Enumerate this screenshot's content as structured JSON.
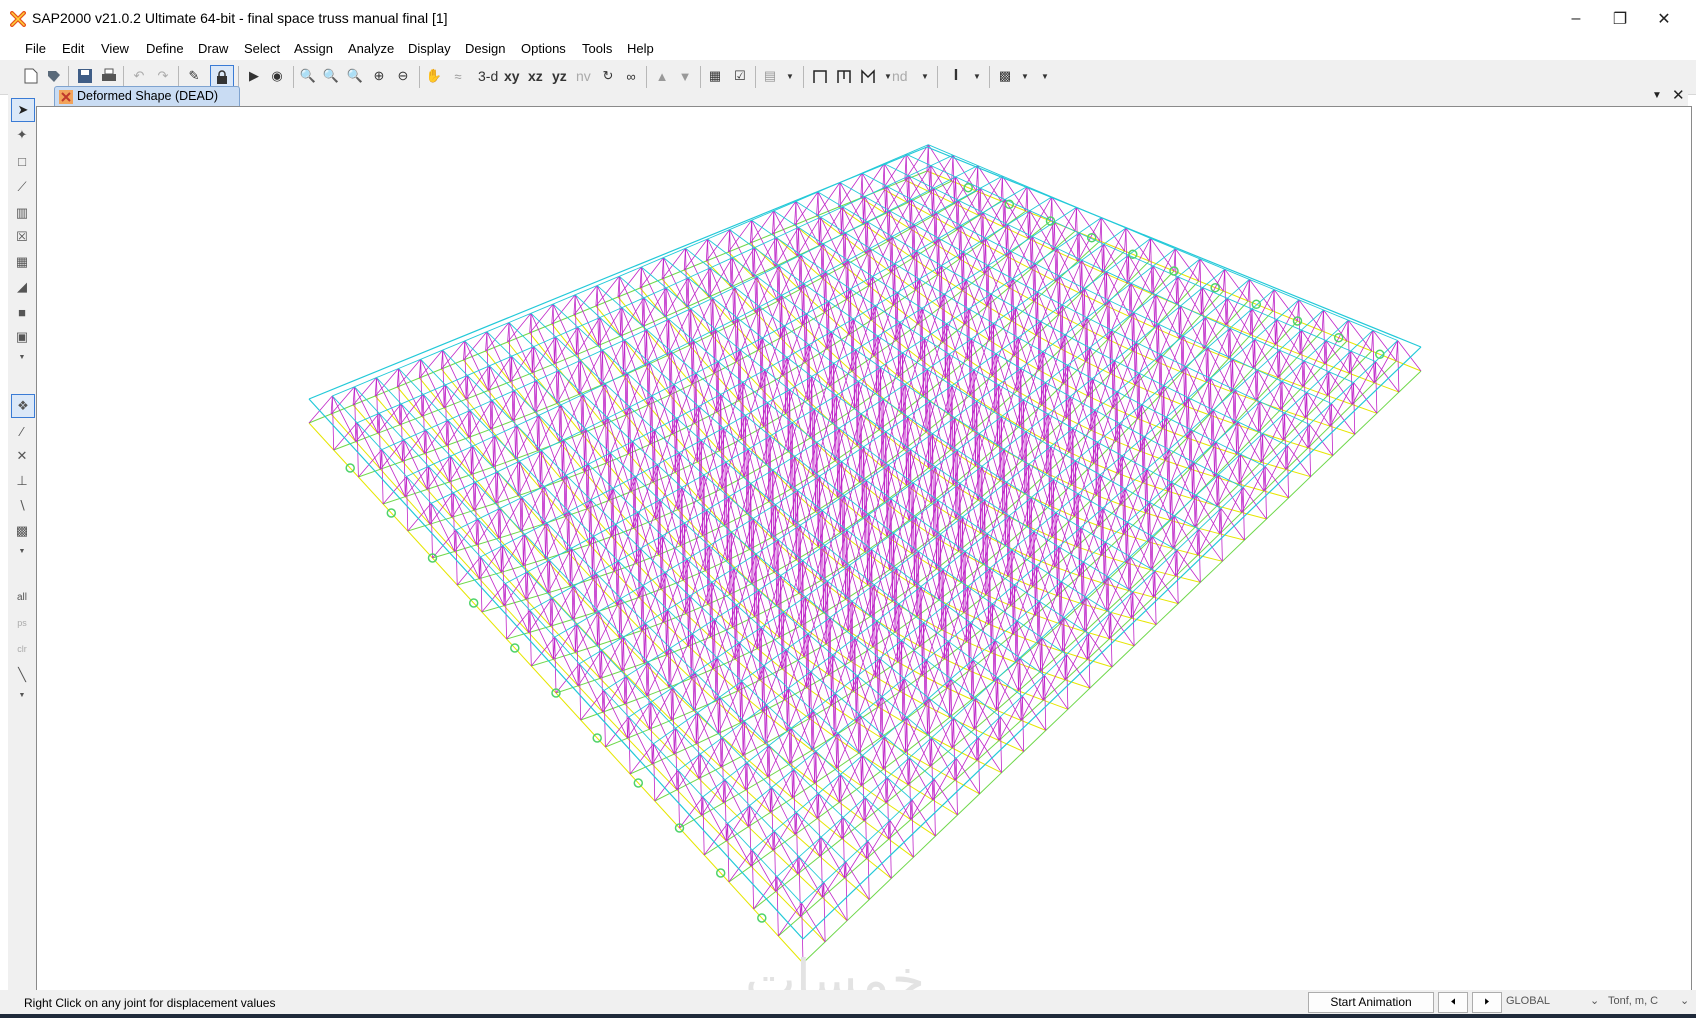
{
  "window": {
    "title": "SAP2000 v21.0.2 Ultimate 64-bit - final space truss manual final [1]",
    "app_icon": "sap2000-x-icon",
    "controls": [
      "minimize-icon",
      "restore-icon",
      "close-icon"
    ]
  },
  "menu": [
    "File",
    "Edit",
    "View",
    "Define",
    "Draw",
    "Select",
    "Assign",
    "Analyze",
    "Display",
    "Design",
    "Options",
    "Tools",
    "Help"
  ],
  "toolbar": {
    "view_3d": "3-d",
    "view_xy": "xy",
    "view_xz": "xz",
    "view_yz": "yz",
    "view_nv": "nv",
    "nd": "nd"
  },
  "tab": {
    "label": "Deformed Shape (DEAD)"
  },
  "status": {
    "message": "Right Click on any joint for displacement values",
    "animation_button": "Start Animation",
    "coord_system": "GLOBAL",
    "units": "Tonf, m, C"
  },
  "watermark": "خمسات",
  "colors": {
    "members_magenta": "#c026c8",
    "members_cyan": "#22c9d8",
    "members_yellow": "#e6e600",
    "members_green": "#6ed84a",
    "tab_fill": "#c9dcf3"
  }
}
